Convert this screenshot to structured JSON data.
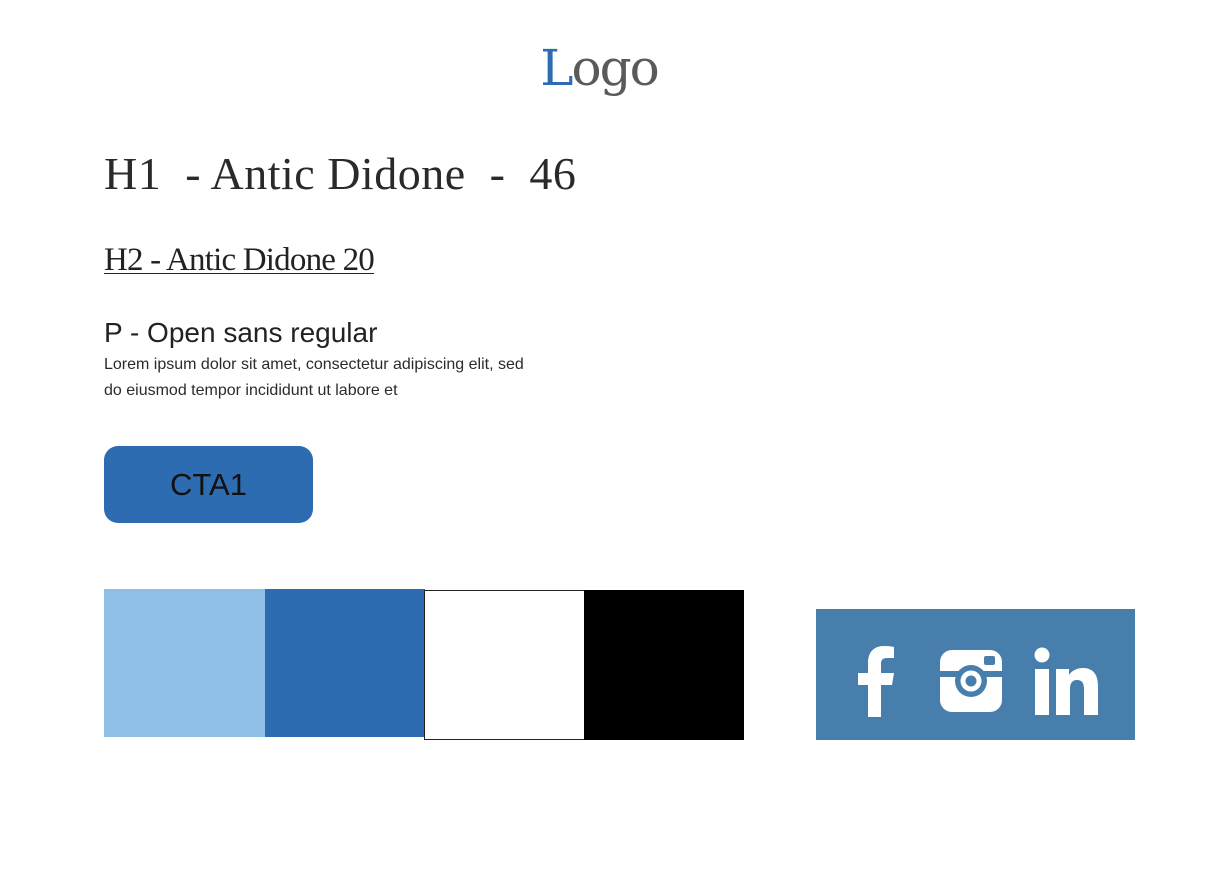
{
  "logo": {
    "part1": "L",
    "part2": "ogo"
  },
  "typography": {
    "h1_sample": "H1  - Antic Didone  -  46",
    "h2_sample": "H2 - Antic Didone 20",
    "p_title": "P - Open sans regular",
    "p_body_line1": "Lorem ipsum dolor sit amet, consectetur adipiscing elit, sed",
    "p_body_line2": "do eiusmod tempor incididunt ut labore et"
  },
  "cta": {
    "label": "CTA1"
  },
  "palette": [
    {
      "color": "#8fbfe7"
    },
    {
      "color": "#2d6cb0"
    },
    {
      "color": "#ffffff"
    },
    {
      "color": "#000000"
    }
  ],
  "social": {
    "background": "#477eac",
    "icons": [
      "facebook-icon",
      "instagram-icon",
      "linkedin-icon"
    ]
  }
}
